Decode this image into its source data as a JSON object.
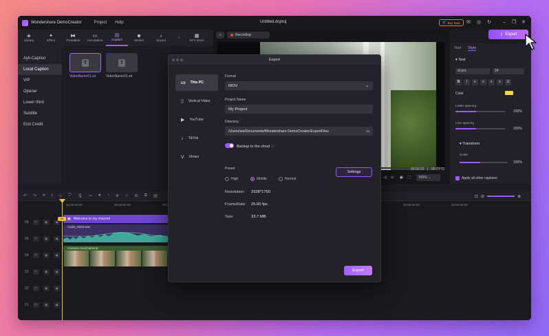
{
  "app": {
    "name": "Wondershare DemoCreator",
    "menu": [
      "Project",
      "Help"
    ],
    "file_title": "Untitled.dcproj",
    "buy_now": "Buy Now"
  },
  "toolbar": {
    "tabs": [
      {
        "label": "Library",
        "icon": "library-icon",
        "glyph": "◈"
      },
      {
        "label": "Effect",
        "icon": "effect-icon",
        "glyph": "✦"
      },
      {
        "label": "Transition",
        "icon": "transition-icon",
        "glyph": "⧓"
      },
      {
        "label": "Annotation",
        "icon": "annotation-icon",
        "glyph": "▭"
      },
      {
        "label": "Caption",
        "icon": "caption-icon",
        "glyph": "▤",
        "active": true
      },
      {
        "label": "Sticker",
        "icon": "sticker-icon",
        "glyph": "☻"
      },
      {
        "label": "Sound",
        "icon": "sound-icon",
        "glyph": "♪"
      },
      {
        "label": "SFX store",
        "icon": "store-icon",
        "glyph": "▦"
      }
    ],
    "more": "»"
  },
  "caption_nav": [
    "Ayti-Caption",
    "Local Caption",
    "VIP",
    "Opener",
    "Lower third",
    "Subtitle",
    "End Credit"
  ],
  "assets": [
    "VideoName01.srt",
    "VideoName01.srt"
  ],
  "preview": {
    "recording": "Recording",
    "current": "00:00:23",
    "total": "00:23:12",
    "zoom": "150%"
  },
  "export_top": "Export",
  "right_panel": {
    "tabs": [
      "Text",
      "Style"
    ],
    "section_text": "Text",
    "font": "st pro",
    "size": "24",
    "color_label": "Color",
    "letter_spacing_label": "Letter spacing",
    "letter_spacing": "150%",
    "line_spacing_label": "Line spacing",
    "line_spacing": "150%",
    "transform": "Transform",
    "scale_label": "Scale",
    "scale": "150%",
    "apply_all": "Apply all other captions"
  },
  "timeline": {
    "ruler": [
      "00:00:00:00",
      "00:00:00:00",
      "00:00:00:00",
      "00:00:00:00",
      "00:00:00:00",
      "00:00:00:00",
      "00:00:00:00",
      "00:00:00:00",
      "00:00:00:00"
    ],
    "playhead": "00:00:00:00",
    "tracks": [
      "06",
      "05",
      "04",
      "03",
      "02",
      "01"
    ],
    "clips": {
      "title": "Welcome to my channel",
      "audio": "Audio_0923.wav",
      "camera": "Camera.mov(Camera)"
    }
  },
  "modal": {
    "title": "Export",
    "targets": [
      "This PC",
      "Vertical Video",
      "YouTube",
      "TikTok",
      "Vimeo"
    ],
    "format_label": "Format",
    "format": "MOV",
    "project_label": "Project Name",
    "project": "My Project",
    "dir_label": "Directory",
    "dir": "/Users/ws/Documents/Wondershare DemoCreator/ExportFiles",
    "backup": "Backup to the cloud",
    "preset_label": "Preset",
    "presets": [
      "High",
      "Middle",
      "Normal"
    ],
    "preset_selected": "Middle",
    "settings": "Settings",
    "resolution_label": "Resolution:",
    "resolution": "2928*1750",
    "framerate_label": "FrameRate:",
    "framerate": "25.00 fps",
    "size_label": "Size:",
    "size": "33.7 MB",
    "export": "Export"
  }
}
